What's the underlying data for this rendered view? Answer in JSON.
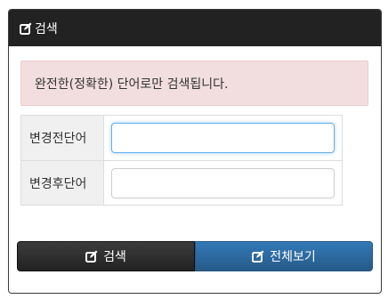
{
  "header": {
    "title": "검색",
    "icon": "edit-icon"
  },
  "alert": {
    "message": "완전한(정확한) 단어로만 검색됩니다."
  },
  "form": {
    "rows": [
      {
        "label": "변경전단어",
        "value": ""
      },
      {
        "label": "변경후단어",
        "value": ""
      }
    ]
  },
  "buttons": {
    "search_label": "검색",
    "view_all_label": "전체보기"
  },
  "colors": {
    "header_bg": "#222222",
    "alert_bg": "#f2dede",
    "primary": "#337ab7"
  }
}
